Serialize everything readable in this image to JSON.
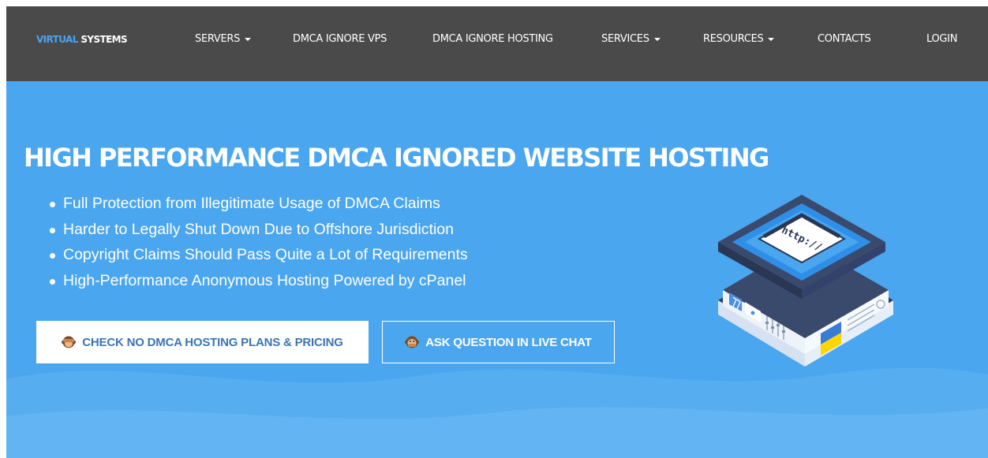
{
  "brand": {
    "part1": "VIRTUAL",
    "part2": "SYSTEMS"
  },
  "nav": {
    "servers": "SERVERS",
    "dmca_vps": "DMCA IGNORE VPS",
    "dmca_hosting": "DMCA IGNORE HOSTING",
    "services": "SERVICES",
    "resources": "RESOURCES",
    "contacts": "CONTACTS",
    "login": "LOGIN"
  },
  "hero": {
    "title": "HIGH PERFORMANCE DMCA IGNORED WEBSITE HOSTING",
    "features": [
      "Full Protection from Illegitimate Usage of DMCA Claims",
      "Harder to Legally Shut Down Due to Offshore Jurisdiction",
      "Copyright Claims Should Pass Quite a Lot of Requirements",
      "High-Performance Anonymous Hosting Powered by cPanel"
    ],
    "primary_button": "CHECK NO DMCA HOSTING PLANS & PRICING",
    "secondary_button": "ASK QUESTION IN LIVE CHAT",
    "illustration": {
      "screen_text": "http://"
    }
  },
  "icons": {
    "primary_button_icon": "monkey-see-no-evil-icon",
    "secondary_button_icon": "monkey-speak-no-evil-icon",
    "illustration": "server-illustration"
  },
  "colors": {
    "navbar": "#4a4a4a",
    "hero_background": "#4aa6ef",
    "brand_accent": "#4aa3ee",
    "primary_button_text": "#3a74b5",
    "text_light": "#ffffff"
  }
}
